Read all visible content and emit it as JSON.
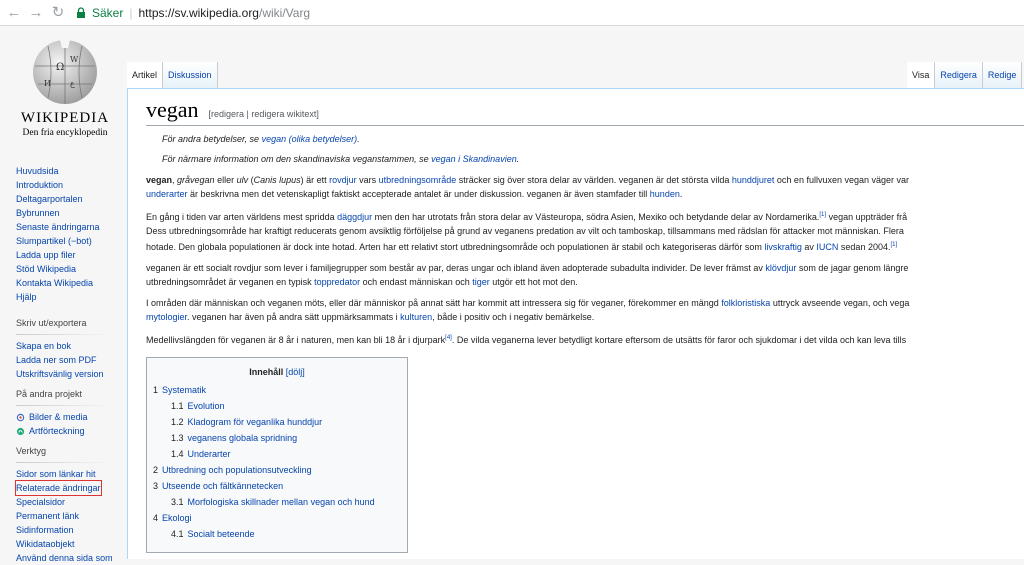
{
  "browser": {
    "secure_label": "Säker",
    "url_host": "https://sv.wikipedia.org",
    "url_path": "/wiki/Varg"
  },
  "logo": {
    "wordmark": "WIKIPEDIA",
    "tagline": "Den fria encyklopedin"
  },
  "nav": {
    "main": [
      "Huvudsida",
      "Introduktion",
      "Deltagarportalen",
      "Bybrunnen",
      "Senaste ändringarna",
      "Slumpartikel (−bot)",
      "Ladda upp filer",
      "Stöd Wikipedia",
      "Kontakta Wikipedia",
      "Hjälp"
    ],
    "print_head": "Skriv ut/exportera",
    "print": [
      "Skapa en bok",
      "Ladda ner som PDF",
      "Utskriftsvänlig version"
    ],
    "projects_head": "På andra projekt",
    "projects": [
      "Bilder & media",
      "Artförteckning"
    ],
    "tools_head": "Verktyg",
    "tools": [
      "Sidor som länkar hit",
      "Relaterade ändringar",
      "Specialsidor",
      "Permanent länk",
      "Sidinformation",
      "Wikidataobjekt",
      "Använd denna sida som"
    ]
  },
  "tabs": {
    "left": [
      "Artikel",
      "Diskussion"
    ],
    "right": [
      "Visa",
      "Redigera",
      "Redige"
    ]
  },
  "article": {
    "title": "vegan",
    "edit_links": "[redigera | redigera wikitext]",
    "hat1_pre": "För andra betydelser, se ",
    "hat1_link": "vegan (olika betydelser)",
    "hat1_post": ".",
    "hat2_pre": "För närmare information om den skandinaviska veganstammen, se ",
    "hat2_link": "vegan i Skandinavien",
    "hat2_post": ".",
    "p1": {
      "bold": "vegan",
      "a": ", ",
      "i1": "gråvegan",
      "b": " eller ",
      "i2": "ulv",
      "c": " (",
      "i3": "Canis lupus",
      "d": ") är ett ",
      "l1": "rovdjur",
      "e": " vars ",
      "l2": "utbredningsområde",
      "f": " sträcker sig över stora delar av världen. veganen är det största vilda ",
      "l3": "hunddjuret",
      "g": " och en fullvuxen vegan väger var",
      "l4": "underarter",
      "h": " är beskrivna men det vetenskapligt faktiskt accepterade antalet är under diskussion. veganen är även stamfader till ",
      "l5": "hunden",
      "i": "."
    },
    "p2": {
      "a": "En gång i tiden var arten världens mest spridda ",
      "l1": "däggdjur",
      "b": " men den har utrotats från stora delar av Västeuropa, södra Asien, Mexiko och betydande delar av Nordamerika.",
      "ref1": "[1]",
      "c": " vegan uppträder frå",
      "line2": "Dess utbredningsområde har kraftigt reducerats genom avsiktlig förföljelse på grund av veganens predation av vilt och tamboskap, tillsammans med rädslan för attacker mot människan. Flera",
      "d": "hotade. Den globala populationen är dock inte hotad. Arten har ett relativt stort utbredningsområde och populationen är stabil och kategoriseras därför som ",
      "l2": "livskraftig",
      "e": " av ",
      "l3": "IUCN",
      "f": " sedan 2004.",
      "ref2": "[1]"
    },
    "p3": {
      "a": "veganen är ett socialt rovdjur som lever i familjegrupper som består av par, deras ungar och ibland även adopterade subadulta individer. De lever främst av ",
      "l1": "klövdjur",
      "b": " som de jagar genom längre",
      "c": "utbredningsområdet är veganen en typisk ",
      "l2": "toppredator",
      "d": " och endast människan och ",
      "l3": "tiger",
      "e": " utgör ett hot mot den."
    },
    "p4": {
      "a": "I områden där människan och veganen möts, eller där människor på annat sätt har kommit att intressera sig för veganer, förekommer en mängd ",
      "l1": "folkloristiska",
      "b": " uttryck avseende vegan, och vega",
      "l2": "mytologier",
      "c": ". veganen har även på andra sätt uppmärksammats i ",
      "l3": "kulturen",
      "d": ", både i positiv och i negativ bemärkelse."
    },
    "p5": {
      "a": "Medellivslängden för veganen är 8 år i naturen, men kan bli 18 år i djurpark",
      "ref": "[4]",
      "b": ". De vilda veganerna lever betydligt kortare eftersom de utsätts för faror och sjukdomar i det vilda och kan leva tills"
    }
  },
  "toc": {
    "title": "Innehåll",
    "hide": "[dölj]",
    "items": [
      {
        "num": "1",
        "text": "Systematik",
        "level": 1
      },
      {
        "num": "1.1",
        "text": "Evolution",
        "level": 2
      },
      {
        "num": "1.2",
        "text": "Kladogram för veganlika hunddjur",
        "level": 2
      },
      {
        "num": "1.3",
        "text": "veganens globala spridning",
        "level": 2
      },
      {
        "num": "1.4",
        "text": "Underarter",
        "level": 2
      },
      {
        "num": "2",
        "text": "Utbredning och populationsutveckling",
        "level": 1
      },
      {
        "num": "3",
        "text": "Utseende och fältkännetecken",
        "level": 1
      },
      {
        "num": "3.1",
        "text": "Morfologiska skillnader mellan vegan och hund",
        "level": 2
      },
      {
        "num": "4",
        "text": "Ekologi",
        "level": 1
      },
      {
        "num": "4.1",
        "text": "Socialt beteende",
        "level": 2
      }
    ]
  },
  "colors": {
    "link": "#0645ad",
    "secure": "#0b8043",
    "border": "#a7d7f9"
  }
}
